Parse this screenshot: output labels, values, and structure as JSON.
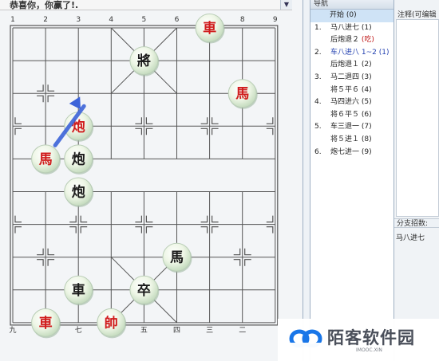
{
  "title_bar": {
    "text": "恭喜你，你赢了!."
  },
  "board": {
    "top_numbers": [
      "1",
      "2",
      "3",
      "4",
      "5",
      "6",
      "7",
      "8",
      "9"
    ],
    "bottom_numbers": [
      "九",
      "",
      "七",
      "",
      "五",
      "四",
      "三",
      "二",
      ""
    ],
    "pieces": [
      {
        "char": "車",
        "side": "red",
        "col": 6,
        "row": 0
      },
      {
        "char": "將",
        "side": "black",
        "col": 4,
        "row": 1
      },
      {
        "char": "馬",
        "side": "red",
        "col": 7,
        "row": 2
      },
      {
        "char": "炮",
        "side": "red",
        "col": 2,
        "row": 3
      },
      {
        "char": "馬",
        "side": "red",
        "col": 1,
        "row": 4
      },
      {
        "char": "炮",
        "side": "black",
        "col": 2,
        "row": 4
      },
      {
        "char": "炮",
        "side": "black",
        "col": 2,
        "row": 5
      },
      {
        "char": "馬",
        "side": "black",
        "col": 5,
        "row": 7
      },
      {
        "char": "車",
        "side": "black",
        "col": 2,
        "row": 8
      },
      {
        "char": "卒",
        "side": "black",
        "col": 4,
        "row": 8
      },
      {
        "char": "車",
        "side": "red",
        "col": 1,
        "row": 9
      },
      {
        "char": "帥",
        "side": "red",
        "col": 3,
        "row": 9
      }
    ],
    "arrow_color": "#3c63d9",
    "red_color": "#d01c1c",
    "black_color": "#1a1a1a"
  },
  "nav": {
    "header": "导航",
    "moves": [
      {
        "num": "",
        "text": "开始 (0)",
        "selected": true
      },
      {
        "num": "1.",
        "text": "马八进七 (1)"
      },
      {
        "num": "",
        "text": "后炮退２",
        "suffix": "(吃)",
        "suffix_color": "red"
      },
      {
        "num": "2.",
        "text": "车八进八 1~2 (1)",
        "color": "blue"
      },
      {
        "num": "",
        "text": "后炮退１ (2)"
      },
      {
        "num": "3.",
        "text": "马二退四 (3)"
      },
      {
        "num": "",
        "text": "将５平６ (4)"
      },
      {
        "num": "4.",
        "text": "马四进六 (5)"
      },
      {
        "num": "",
        "text": "将６平５ (6)"
      },
      {
        "num": "5.",
        "text": "车三退一 (7)"
      },
      {
        "num": "",
        "text": "将５进１ (8)"
      },
      {
        "num": "6.",
        "text": "炮七进一 (9)"
      }
    ]
  },
  "comment": {
    "header": "注释(可编辑"
  },
  "branch": {
    "label": "分支招数:",
    "item": "马八进七"
  },
  "watermark": {
    "title": "陌客软件园",
    "sub": "IMOOC.XIN"
  }
}
